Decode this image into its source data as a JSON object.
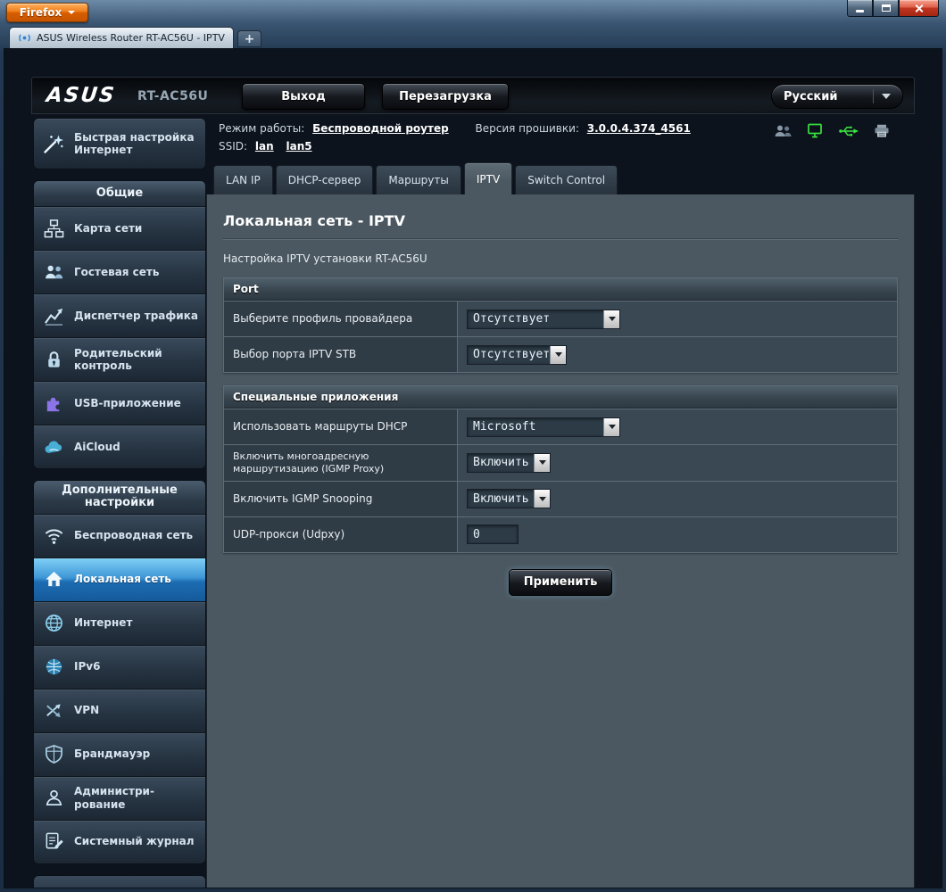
{
  "window": {
    "firefox_button": "Firefox",
    "tab_title": "ASUS Wireless Router RT-AC56U - IPTV",
    "new_tab_label": "+"
  },
  "header": {
    "brand": "ASUS",
    "model": "RT-AC56U",
    "logout_label": "Выход",
    "reboot_label": "Перезагрузка",
    "language": "Русский"
  },
  "status": {
    "mode_label": "Режим работы:",
    "mode_value": "Беспроводной роутер",
    "firmware_label": "Версия прошивки:",
    "firmware_value": "3.0.0.4.374_4561",
    "ssid_label": "SSID:",
    "ssid1": "lan",
    "ssid2": "lan5"
  },
  "tabs": [
    {
      "label": "LAN IP"
    },
    {
      "label": "DHCP-сервер"
    },
    {
      "label": "Маршруты"
    },
    {
      "label": "IPTV"
    },
    {
      "label": "Switch Control"
    }
  ],
  "main": {
    "title": "Локальная сеть - IPTV",
    "description": "Настройка IPTV установки RT-AC56U",
    "sections": [
      {
        "title": "Port",
        "rows": [
          {
            "label": "Выберите профиль провайдера",
            "control": "select",
            "value": "Отсутствует"
          },
          {
            "label": "Выбор порта IPTV STB",
            "control": "select",
            "value": "Отсутствует"
          }
        ]
      },
      {
        "title": "Специальные приложения",
        "rows": [
          {
            "label": "Использовать маршруты DHCP",
            "control": "select",
            "value": "Microsoft"
          },
          {
            "label": "Включить многоадресную маршрутизацию (IGMP Proxy)",
            "control": "select",
            "value": "Включить"
          },
          {
            "label": "Включить IGMP Snooping",
            "control": "select",
            "value": "Включить"
          },
          {
            "label": "UDP-прокси (Udpxy)",
            "control": "input",
            "value": "0"
          }
        ]
      }
    ],
    "apply_label": "Применить"
  },
  "sidebar": {
    "quick_setup": "Быстрая настройка Интернет",
    "sections": [
      {
        "title": "Общие",
        "items": [
          {
            "label": "Карта сети",
            "icon": "network-map"
          },
          {
            "label": "Гостевая сеть",
            "icon": "guest-network"
          },
          {
            "label": "Диспетчер трафика",
            "icon": "traffic-manager"
          },
          {
            "label": "Родительский контроль",
            "icon": "parental-control"
          },
          {
            "label": "USB-приложение",
            "icon": "usb-application"
          },
          {
            "label": "AiCloud",
            "icon": "aicloud"
          }
        ]
      },
      {
        "title": "Дополнительные настройки",
        "items": [
          {
            "label": "Беспроводная сеть",
            "icon": "wireless"
          },
          {
            "label": "Локальная сеть",
            "icon": "lan-home",
            "active": true
          },
          {
            "label": "Интернет",
            "icon": "internet-globe"
          },
          {
            "label": "IPv6",
            "icon": "ipv6-globe"
          },
          {
            "label": "VPN",
            "icon": "vpn-arrows"
          },
          {
            "label": "Брандмауэр",
            "icon": "firewall-shield"
          },
          {
            "label": "Администри-рование",
            "icon": "administration-person"
          },
          {
            "label": "Системный журнал",
            "icon": "system-log-document"
          }
        ]
      }
    ]
  }
}
